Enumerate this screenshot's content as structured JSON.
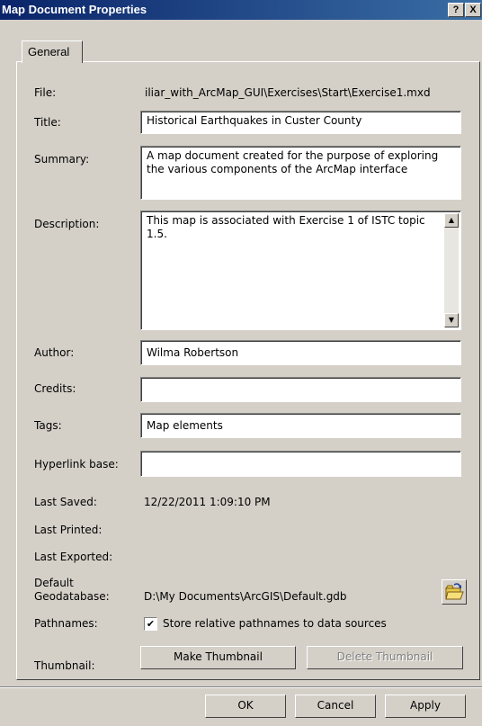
{
  "window": {
    "title": "Map Document Properties",
    "help_button": "?",
    "close_button": "X"
  },
  "tabs": [
    {
      "label": "General"
    }
  ],
  "fields": {
    "file_label": "File:",
    "file_value": "iliar_with_ArcMap_GUI\\Exercises\\Start\\Exercise1.mxd",
    "title_label": "Title:",
    "title_value": "Historical Earthquakes in Custer County",
    "summary_label": "Summary:",
    "summary_value": "A map document created for the purpose of exploring the various components of the ArcMap interface",
    "description_label": "Description:",
    "description_value": "This map is associated with Exercise 1 of ISTC topic 1.5.",
    "author_label": "Author:",
    "author_value": "Wilma Robertson",
    "credits_label": "Credits:",
    "credits_value": "",
    "tags_label": "Tags:",
    "tags_value": "Map elements",
    "hyperlink_label": "Hyperlink base:",
    "hyperlink_value": "",
    "last_saved_label": "Last Saved:",
    "last_saved_value": "12/22/2011 1:09:10 PM",
    "last_printed_label": "Last Printed:",
    "last_exported_label": "Last Exported:",
    "default_geodb_label_1": "Default",
    "default_geodb_label_2": "Geodatabase:",
    "default_geodb_value": "D:\\My Documents\\ArcGIS\\Default.gdb",
    "pathnames_label": "Pathnames:",
    "pathnames_checkbox_label": "Store relative pathnames to data sources",
    "pathnames_checked": true,
    "thumbnail_label": "Thumbnail:"
  },
  "buttons": {
    "make_thumbnail": "Make Thumbnail",
    "delete_thumbnail": "Delete Thumbnail",
    "ok": "OK",
    "cancel": "Cancel",
    "apply": "Apply"
  },
  "icons": {
    "checkbox_mark": "✔",
    "scroll_up": "▲",
    "scroll_down": "▼",
    "folder": "folder-open-icon"
  },
  "colors": {
    "titlebar_start": "#0a246a",
    "titlebar_end": "#3a6ea5",
    "face": "#d4d0c8"
  }
}
